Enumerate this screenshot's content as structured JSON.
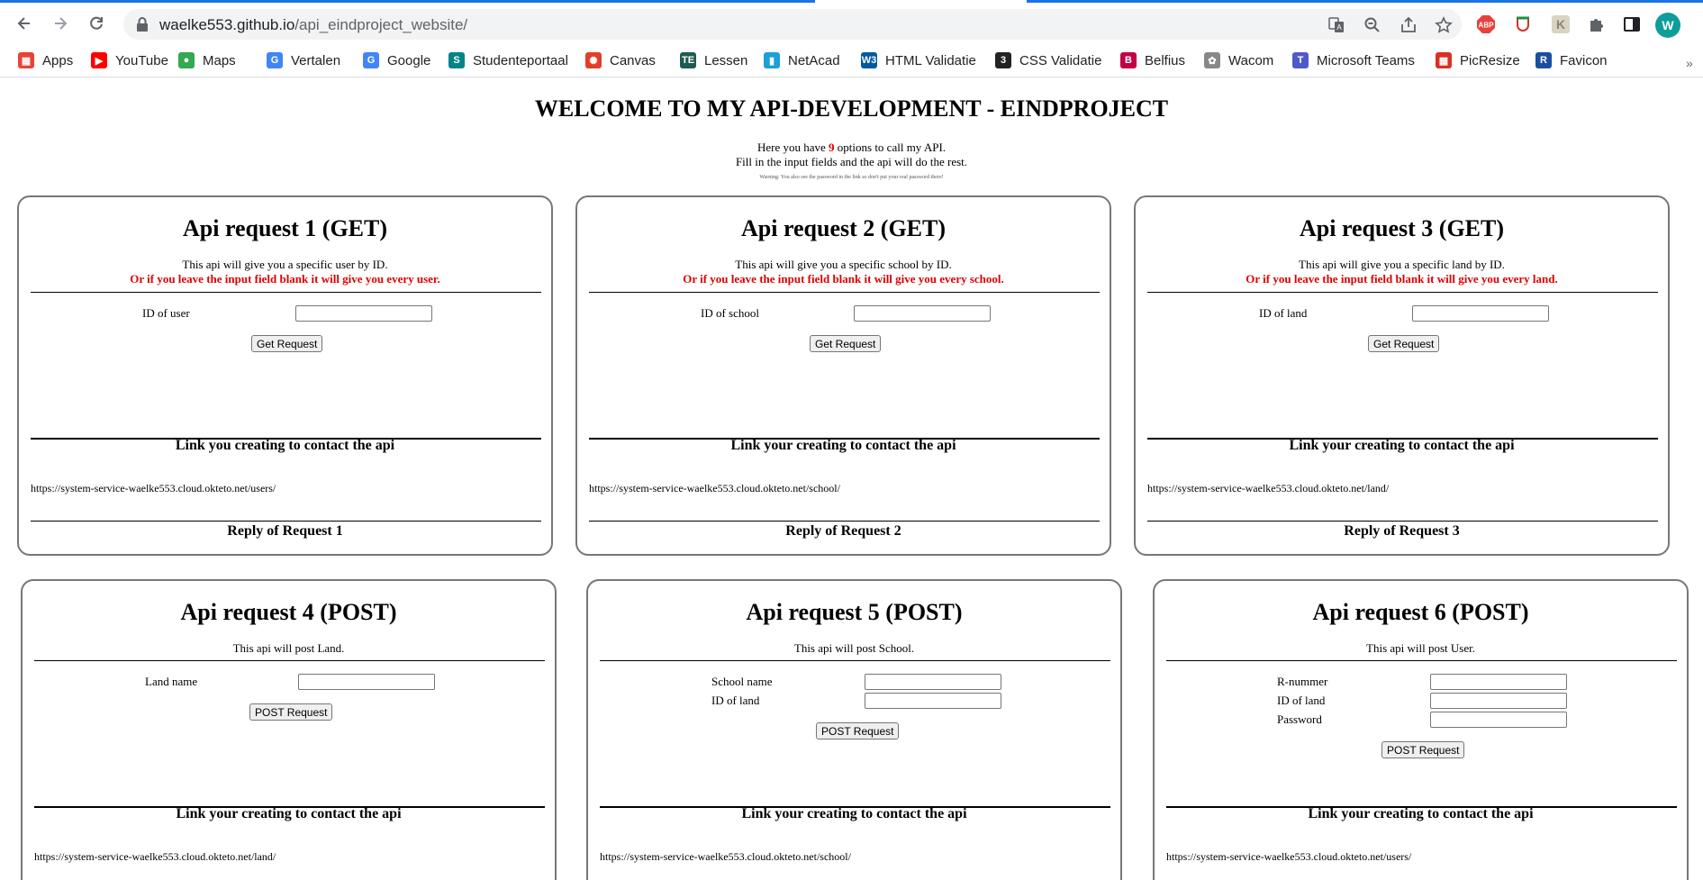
{
  "browser": {
    "url_host": "waelke553.github.io",
    "url_path": "/api_eindproject_website/",
    "avatar_letter": "W",
    "bookmarks": [
      {
        "label": "Apps",
        "icon": "apps-grid-icon",
        "color": "#ea4335"
      },
      {
        "label": "YouTube",
        "icon": "youtube-icon",
        "color": "#ff0000"
      },
      {
        "label": "Maps",
        "icon": "maps-pin-icon",
        "color": "#34a853"
      },
      {
        "label": "Vertalen",
        "icon": "translate-icon",
        "color": "#4285f4"
      },
      {
        "label": "Google",
        "icon": "google-icon",
        "color": "#4285f4"
      },
      {
        "label": "Studenteportaal",
        "icon": "sharepoint-icon",
        "color": "#038387"
      },
      {
        "label": "Canvas",
        "icon": "canvas-icon",
        "color": "#e13f2b"
      },
      {
        "label": "Lessen",
        "icon": "te-icon",
        "color": "#1d5b52"
      },
      {
        "label": "NetAcad",
        "icon": "cisco-icon",
        "color": "#1ba0d7"
      },
      {
        "label": "HTML Validatie",
        "icon": "w3c-icon",
        "color": "#005a9c"
      },
      {
        "label": "CSS Validatie",
        "icon": "css-icon",
        "color": "#222222"
      },
      {
        "label": "Belfius",
        "icon": "belfius-icon",
        "color": "#c30045"
      },
      {
        "label": "Wacom",
        "icon": "wacom-icon",
        "color": "#888888"
      },
      {
        "label": "Microsoft Teams",
        "icon": "teams-icon",
        "color": "#5059c9"
      },
      {
        "label": "PicResize",
        "icon": "picresize-icon",
        "color": "#d93025"
      },
      {
        "label": "Favicon",
        "icon": "favicon-icon",
        "color": "#1a4fa0"
      }
    ]
  },
  "page": {
    "title": "WELCOME TO MY API-DEVELOPMENT - EINDPROJECT",
    "intro_pre": "Here you have ",
    "intro_count": "9",
    "intro_post": " options to call my API.",
    "intro_line2": "Fill in the input fields and the api will do the rest.",
    "warning": "Warning: You also see the password in the link so don't put your real password there!"
  },
  "cards": [
    {
      "title": "Api request 1 (GET)",
      "desc": "This api will give you a specific user by ID.",
      "desc_red": "Or if you leave the input field blank it will give you every user.",
      "fields": [
        {
          "label": "ID of user",
          "value": ""
        }
      ],
      "button": "Get Request",
      "link_heading": "Link you creating to contact the api",
      "link": "https://system-service-waelke553.cloud.okteto.net/users/",
      "reply_heading": "Reply of Request 1"
    },
    {
      "title": "Api request 2 (GET)",
      "desc": "This api will give you a specific school by ID.",
      "desc_red": "Or if you leave the input field blank it will give you every school.",
      "fields": [
        {
          "label": "ID of school",
          "value": ""
        }
      ],
      "button": "Get Request",
      "link_heading": "Link your creating to contact the api",
      "link": "https://system-service-waelke553.cloud.okteto.net/school/",
      "reply_heading": "Reply of Request 2"
    },
    {
      "title": "Api request 3 (GET)",
      "desc": "This api will give you a specific land by ID.",
      "desc_red": "Or if you leave the input field blank it will give you every land.",
      "fields": [
        {
          "label": "ID of land",
          "value": ""
        }
      ],
      "button": "Get Request",
      "link_heading": "Link your creating to contact the api",
      "link": "https://system-service-waelke553.cloud.okteto.net/land/",
      "reply_heading": "Reply of Request 3"
    },
    {
      "title": "Api request 4 (POST)",
      "desc": "This api will post Land.",
      "fields": [
        {
          "label": "Land name",
          "value": ""
        }
      ],
      "button": "POST Request",
      "link_heading": "Link your creating to contact the api",
      "link": "https://system-service-waelke553.cloud.okteto.net/land/"
    },
    {
      "title": "Api request 5 (POST)",
      "desc": "This api will post School.",
      "fields": [
        {
          "label": "School name",
          "value": ""
        },
        {
          "label": "ID of land",
          "value": ""
        }
      ],
      "button": "POST Request",
      "link_heading": "Link your creating to contact the api",
      "link": "https://system-service-waelke553.cloud.okteto.net/school/"
    },
    {
      "title": "Api request 6 (POST)",
      "desc": "This api will post User.",
      "fields": [
        {
          "label": "R-nummer",
          "value": ""
        },
        {
          "label": "ID of land",
          "value": ""
        },
        {
          "label": "Password",
          "value": ""
        }
      ],
      "button": "POST Request",
      "link_heading": "Link your creating to contact the api",
      "link": "https://system-service-waelke553.cloud.okteto.net/users/"
    }
  ]
}
